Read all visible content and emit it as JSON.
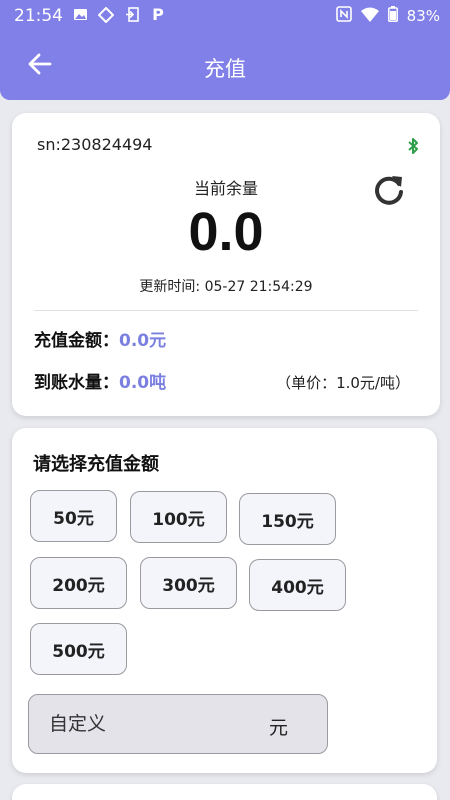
{
  "status": {
    "time": "21:54",
    "battery": "83%"
  },
  "header": {
    "title": "充值"
  },
  "device": {
    "sn": "sn:230824494",
    "balance_label": "当前余量",
    "balance_value": "0.0",
    "update_time": "更新时间: 05-27 21:54:29",
    "recharge_amount_label": "充值金额：",
    "recharge_amount_value": "0.0元",
    "water_amount_label": "到账水量：",
    "water_amount_value": "0.0吨",
    "unit_price": "（单价：1.0元/吨）"
  },
  "amounts": {
    "title": "请选择充值金额",
    "options": [
      "50元",
      "100元",
      "150元",
      "200元",
      "300元",
      "400元",
      "500元"
    ],
    "custom_placeholder": "自定义",
    "custom_unit": "元"
  },
  "colors": {
    "accent": "#8080e8",
    "value_text": "#7b7fe0",
    "bluetooth": "#2e9e4a"
  }
}
